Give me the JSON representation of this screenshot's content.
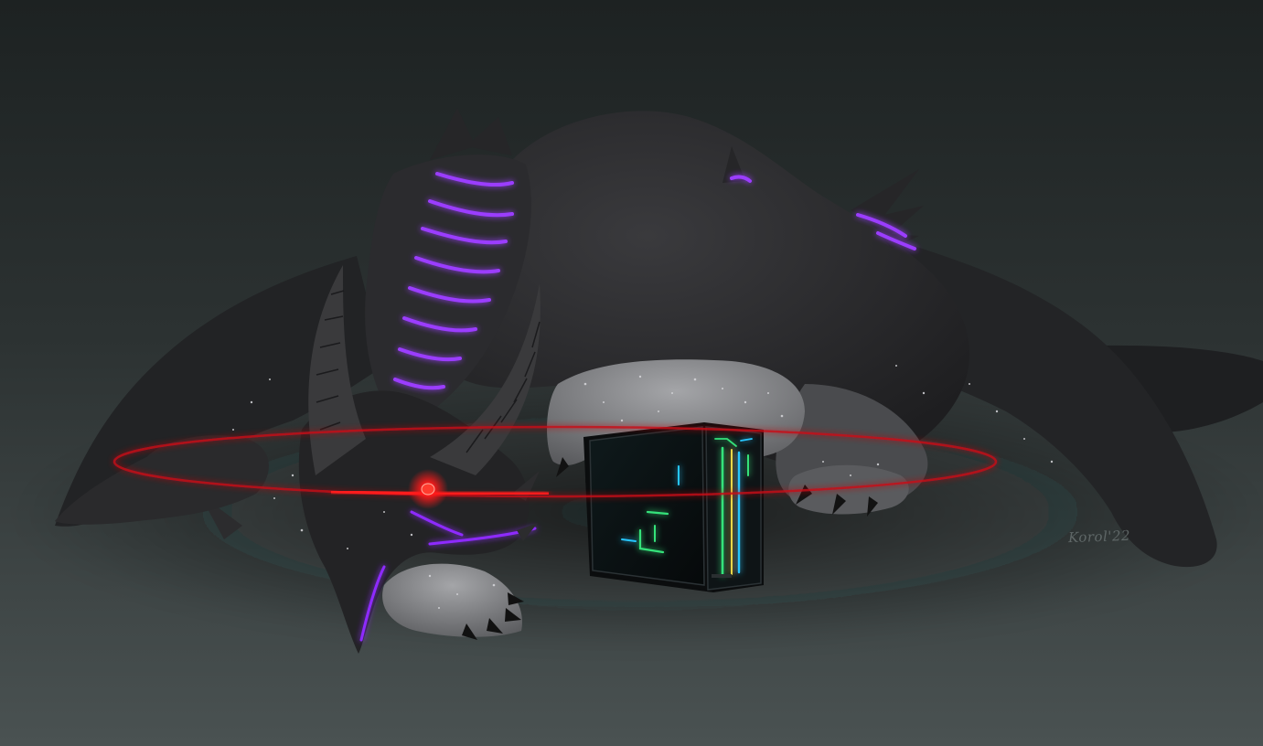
{
  "artwork": {
    "signature": "Korol'22",
    "subject_icons": [
      "dragon-icon",
      "pc-case-icon",
      "red-eye-laser-icon"
    ]
  },
  "colors": {
    "background_top": "#1f2424",
    "background_floor": "#474e4e",
    "dragon_body": "#2a2a2c",
    "dragon_highlight": "#4d4d50",
    "paw_grey": "#8e8f92",
    "spine_glow": "#9b3cff",
    "eye_red": "#ff2a2a",
    "laser_red": "#e0141a",
    "pc_green": "#34e27a",
    "pc_cyan": "#27c6ff",
    "pc_yellow": "#e8d64a"
  }
}
